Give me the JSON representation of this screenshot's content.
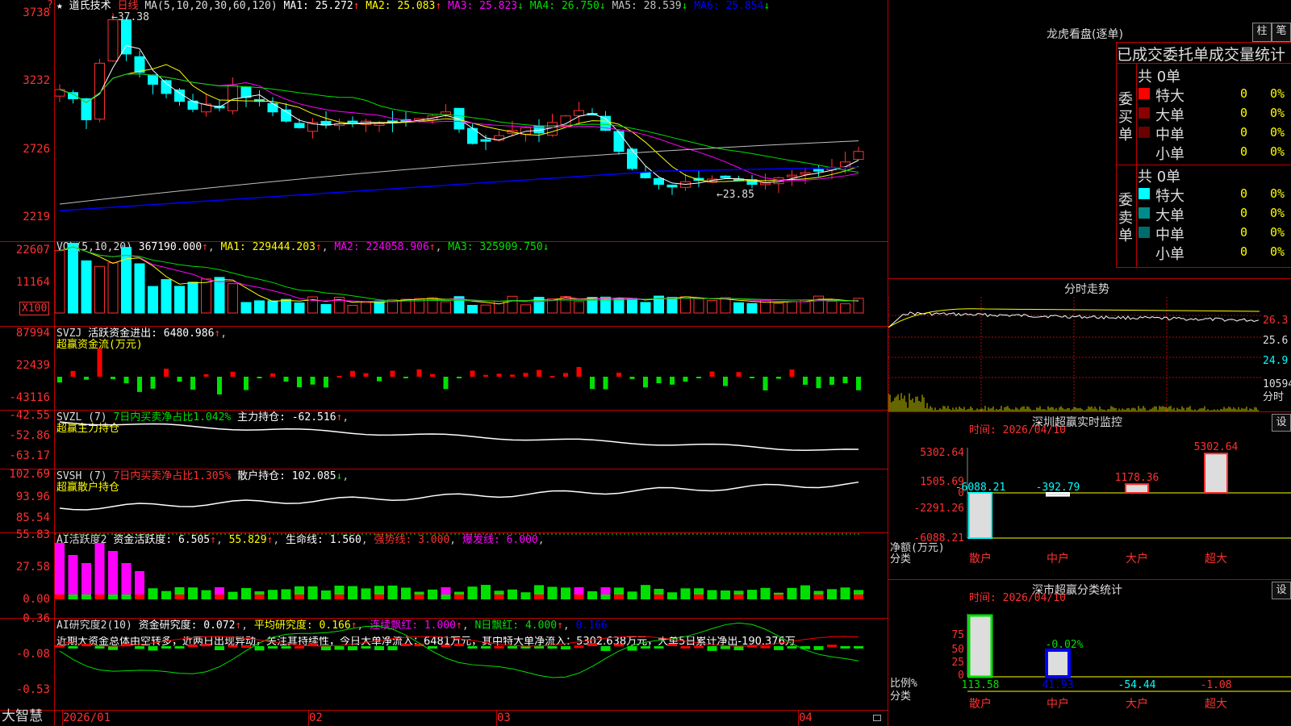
{
  "stock": {
    "star": "★",
    "name": "道氏技术",
    "period": "日线"
  },
  "main": {
    "ma_title": "MA(5,10,20,30,60,120)",
    "ma": [
      {
        "label": "MA1: 25.272",
        "arrow": "↑",
        "color": "#ffffff"
      },
      {
        "label": "MA2: 25.083",
        "arrow": "↑",
        "color": "#ffff00"
      },
      {
        "label": "MA3: 25.823",
        "arrow": "↓",
        "color": "#ff00ff"
      },
      {
        "label": "MA4: 26.750",
        "arrow": "↓",
        "color": "#00e000"
      },
      {
        "label": "MA5: 28.539",
        "arrow": "↓",
        "color": "#c0c0c0"
      },
      {
        "label": "MA6: 25.854",
        "arrow": "↓",
        "color": "#0000ff"
      }
    ],
    "y_labels": [
      "3738",
      "3232",
      "2726",
      "2219"
    ],
    "high_note": "37.38",
    "low_note": "23.85",
    "corner": "?"
  },
  "vol": {
    "title": "VOL(5,10,20)",
    "value": "367190.000",
    "ma1": "MA1: 229444.203",
    "ma2": "MA2: 224058.906",
    "ma3": "MA3: 325909.750",
    "arrow": "↑",
    "y_labels": [
      "22607",
      "11164"
    ],
    "unit": "X100"
  },
  "svzj": {
    "title": "SVZJ",
    "label": "活跃资金进出: 6480.986",
    "arrow": "↑",
    "subtitle": "超赢资金流(万元)",
    "y_labels": [
      "87994",
      "22439",
      "-43116"
    ]
  },
  "svzl": {
    "title": "SVZL (7)",
    "ratio": "7日内买卖净占比1.042%",
    "label": "主力持仓: -62.516",
    "arrow": "↑",
    "subtitle": "超赢主力持仓",
    "y_labels": [
      "-42.55",
      "-52.86",
      "-63.17"
    ]
  },
  "svsh": {
    "title": "SVSH (7)",
    "ratio": "7日内买卖净占比1.305%",
    "label": "散户持仓: 102.085",
    "arrow": "↓",
    "subtitle": "超赢散户持仓",
    "y_labels": [
      "102.69",
      "93.96",
      "85.54"
    ]
  },
  "ai1": {
    "title": "AI活跃度2",
    "label1": "资金活跃度: 6.505",
    "v2": "55.829",
    "label3": "生命线: 1.560",
    "label4": "强势线: 3.000",
    "label5": "爆发线: 6.000",
    "y_labels": [
      "55.83",
      "27.58",
      "0.00"
    ]
  },
  "ai2": {
    "title": "AI研究度2(10)",
    "label1": "资金研究度: 0.072",
    "label2": "平均研究度: 0.166",
    "label3": "连续飘红: 1.000",
    "label4": "N日飘红: 4.000",
    "label5": "0.166",
    "note": "近期大资金总体由空转多，近两日出现异动，关注其持续性，今日大单净流入：6481万元，其中特大单净流入：5302.638万元，大单5日累计净出-190.376万",
    "y_labels": [
      "0.36",
      "-0.08",
      "-0.53"
    ]
  },
  "bottom": {
    "brand": "大智慧",
    "dates": [
      "2026/01",
      "02",
      "03",
      "04"
    ]
  },
  "right": {
    "lhkp_title": "龙虎看盘(逐单)",
    "btn1": "柱",
    "btn2": "笔",
    "tabs_text": "已成交委托单成交量统计",
    "buy": {
      "side": "委买单",
      "total": "共 0单",
      "rows": [
        {
          "label": "特大",
          "n": "0",
          "p": "0%",
          "color": "#ff0000"
        },
        {
          "label": "大单",
          "n": "0",
          "p": "0%",
          "color": "#8b0000"
        },
        {
          "label": "中单",
          "n": "0",
          "p": "0%",
          "color": "#6b0000"
        },
        {
          "label": "小单",
          "n": "0",
          "p": "0%",
          "color": "#000000"
        }
      ]
    },
    "sell": {
      "side": "委卖单",
      "total": "共 0单",
      "rows": [
        {
          "label": "特大",
          "n": "0",
          "p": "0%",
          "color": "#00ffff"
        },
        {
          "label": "大单",
          "n": "0",
          "p": "0%",
          "color": "#008b8b"
        },
        {
          "label": "中单",
          "n": "0",
          "p": "0%",
          "color": "#006b6b"
        },
        {
          "label": "小单",
          "n": "0",
          "p": "0%",
          "color": "#000000"
        }
      ]
    },
    "fs_title": "分时走势",
    "fs_labels": [
      "26.3",
      "25.6",
      "24.9"
    ],
    "fs_vol": "10594",
    "fs_unit": "分时",
    "sz_title": "深圳超赢实时监控",
    "sz_time": "时间: 2026/04/10",
    "sz_set": "设",
    "sz_y": [
      "5302.64",
      "1505.69",
      "0",
      "-2291.26",
      "-6088.21"
    ],
    "sz_unit": "净额(万元)",
    "sz_cat_label": "分类",
    "sz_values": [
      "-6088.21",
      "-392.79",
      "1178.36",
      "5302.64"
    ],
    "cats": [
      "散户",
      "中户",
      "大户",
      "超大"
    ],
    "fl_title": "深市超赢分类统计",
    "fl_time": "时间: 2026/04/10",
    "fl_set": "设",
    "fl_y": [
      "75",
      "50",
      "25",
      "0"
    ],
    "fl_unit": "比例%",
    "fl_cat_label": "分类",
    "fl_pct": "-0.02%",
    "fl_values": [
      "113.58",
      "41.93",
      "-54.44",
      "-1.08"
    ]
  }
}
